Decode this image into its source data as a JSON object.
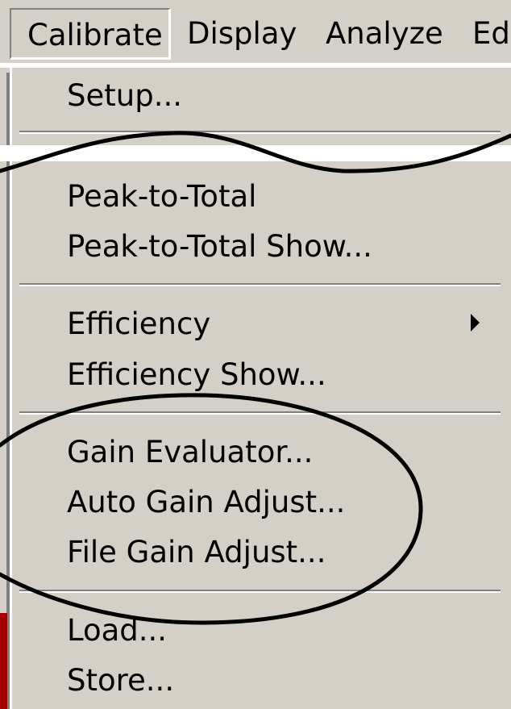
{
  "menubar": {
    "items": [
      {
        "label": "Calibrate"
      },
      {
        "label": "Display"
      },
      {
        "label": "Analyze"
      },
      {
        "label": "Ed"
      }
    ]
  },
  "dropdown": {
    "items": [
      {
        "label": "Setup..."
      },
      {
        "label": "Peak-to-Total"
      },
      {
        "label": "Peak-to-Total Show..."
      },
      {
        "label": "Efficiency",
        "has_submenu": true
      },
      {
        "label": "Efficiency Show..."
      },
      {
        "label": "Gain Evaluator..."
      },
      {
        "label": "Auto Gain Adjust..."
      },
      {
        "label": "File Gain Adjust..."
      },
      {
        "label": "Load..."
      },
      {
        "label": "Store..."
      }
    ]
  },
  "colors": {
    "menu_bg": "#d4d0c8",
    "shadow": "#808080",
    "highlight": "#ffffff",
    "window_edge": "#a40000",
    "annotation_ink": "#000000"
  },
  "icons": {
    "submenu": "submenu-arrow-icon"
  }
}
